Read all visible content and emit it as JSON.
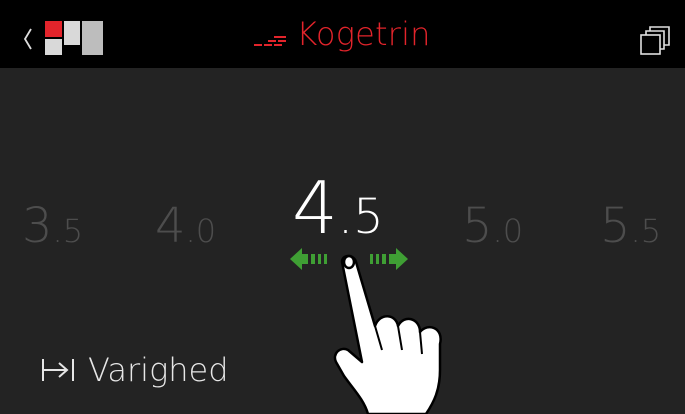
{
  "header": {
    "back_icon": "chevron-left-icon",
    "cooktop_icon": "cooktop-zones-icon",
    "title": "Kogetrin",
    "title_icon": "heat-level-icon",
    "menu_icon": "copy-windows-icon"
  },
  "selector": {
    "values": [
      {
        "int": "3",
        "dec": ".5"
      },
      {
        "int": "4",
        "dec": ".0"
      },
      {
        "int": "4",
        "dec": ".5"
      },
      {
        "int": "5",
        "dec": ".0"
      },
      {
        "int": "5",
        "dec": ".5"
      }
    ],
    "selected_index": 2,
    "swipe_icon": "swipe-left-right-icon"
  },
  "duration": {
    "icon": "duration-to-end-icon",
    "label": "Varighed"
  },
  "overlay": {
    "hand_icon": "tap-hand-icon"
  },
  "colors": {
    "accent": "#e3242b",
    "arrow": "#3f9f34",
    "background": "#232323",
    "header": "#000000"
  }
}
